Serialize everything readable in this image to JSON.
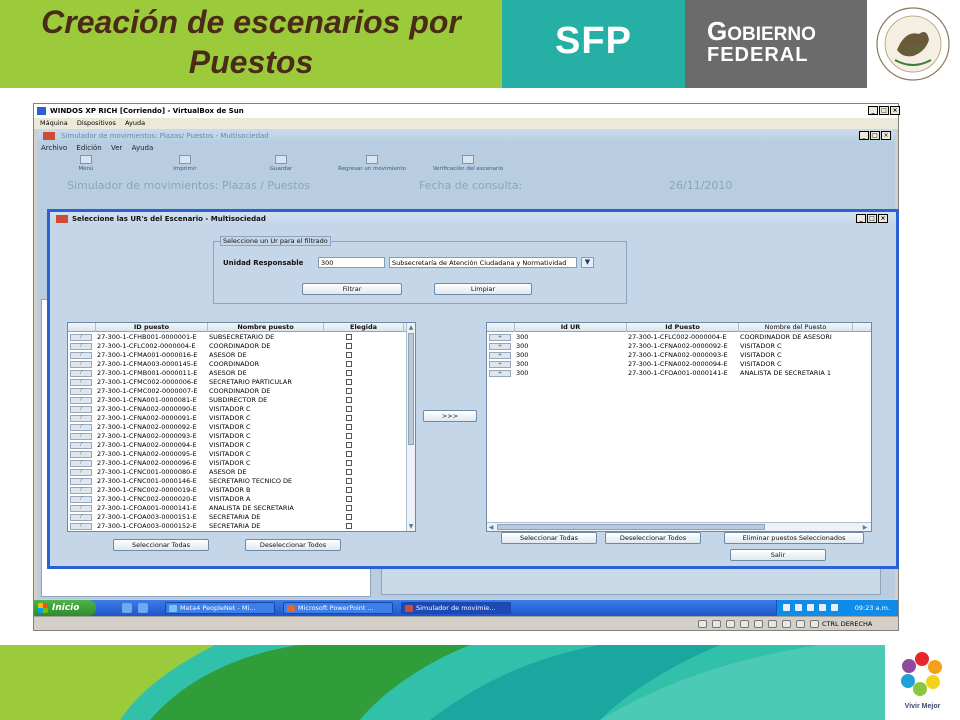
{
  "slide": {
    "title": "Creación de escenarios por Puestos",
    "sfp_logo": "SFP",
    "gobierno_line1": "Gobierno",
    "gobierno_line2": "FEDERAL",
    "seal_text": "ESTADOS UNIDOS MEXICANOS",
    "footer_logo_text": "Vivir Mejor"
  },
  "vm": {
    "title": "WINDOS XP RICH [Corriendo] - VirtualBox de Sun",
    "menu": [
      "Máquina",
      "Dispositivos",
      "Ayuda"
    ],
    "status_text": "CTRL DERECHA"
  },
  "app": {
    "title": "Simulador de movimientos: Plazas/ Puestos - Multisociedad",
    "menu": [
      "Archivo",
      "Edición",
      "Ver",
      "Ayuda"
    ],
    "toolbar": [
      "Menú",
      "Imprimir",
      "Guardar",
      "Regresar un movimiento",
      "Verificación del escenario"
    ],
    "ghost_title": "Simulador de movimientos: Plazas / Puestos",
    "ghost_date_label": "Fecha de consulta:",
    "ghost_date": "26/11/2010"
  },
  "dialog": {
    "title": "Seleccione las UR's del Escenario - Multisociedad",
    "filter_legend": "Seleccione un Ur para el filtrado",
    "unidad_label": "Unidad Responsable",
    "unidad_code": "300",
    "unidad_desc": "Subsecretaría de Atención Ciudadana y Normatividad",
    "filtrar_label": "Filtrar",
    "limpiar_label": "Limpiar",
    "move_label": ">>>",
    "left_select_all": "Seleccionar Todas",
    "left_deselect_all": "Deseleccionar Todos",
    "right_select_all": "Seleccionar Todas",
    "right_deselect_all": "Deseleccionar Todos",
    "remove_selected": "Eliminar puestos Seleccionados",
    "exit_label": "Salir"
  },
  "left_table": {
    "headers": [
      "ID puesto",
      "Nombre puesto",
      "Elegida"
    ],
    "rows": [
      [
        "27-300-1-CFHB001-0000001-E",
        "SUBSECRETARIO DE"
      ],
      [
        "27-300-1-CFLC002-0000004-E",
        "COORDINADOR DE"
      ],
      [
        "27-300-1-CFMA001-0000016-E",
        "ASESOR DE"
      ],
      [
        "27-300-1-CFMA003-0000145-E",
        "COORDINADOR"
      ],
      [
        "27-300-1-CFMB001-0000011-E",
        "ASESOR DE"
      ],
      [
        "27-300-1-CFMC002-0000006-E",
        "SECRETARIO PARTICULAR"
      ],
      [
        "27-300-1-CFMC002-0000007-E",
        "COORDINADOR DE"
      ],
      [
        "27-300-1-CFNA001-0000081-E",
        "SUBDIRECTOR DE"
      ],
      [
        "27-300-1-CFNA002-0000090-E",
        "VISITADOR C"
      ],
      [
        "27-300-1-CFNA002-0000091-E",
        "VISITADOR C"
      ],
      [
        "27-300-1-CFNA002-0000092-E",
        "VISITADOR C"
      ],
      [
        "27-300-1-CFNA002-0000093-E",
        "VISITADOR C"
      ],
      [
        "27-300-1-CFNA002-0000094-E",
        "VISITADOR C"
      ],
      [
        "27-300-1-CFNA002-0000095-E",
        "VISITADOR C"
      ],
      [
        "27-300-1-CFNA002-0000096-E",
        "VISITADOR C"
      ],
      [
        "27-300-1-CFNC001-0000080-E",
        "ASESOR DE"
      ],
      [
        "27-300-1-CFNC001-0000146-E",
        "SECRETARIO TECNICO DE"
      ],
      [
        "27-300-1-CFNC002-0000019-E",
        "VISITADOR B"
      ],
      [
        "27-300-1-CFNC002-0000020-E",
        "VISITADOR A"
      ],
      [
        "27-300-1-CFOA001-0000141-E",
        "ANALISTA DE SECRETARIA"
      ],
      [
        "27-300-1-CFOA003-0000151-E",
        "SECRETARIA DE"
      ],
      [
        "27-300-1-CFOA003-0000152-E",
        "SECRETARIA DE"
      ]
    ]
  },
  "right_table": {
    "headers": [
      "Id UR",
      "Id Puesto",
      "Nombre del Puesto"
    ],
    "rows": [
      [
        "300",
        "27-300-1-CFLC002-0000004-E",
        "COORDINADOR DE ASESORI"
      ],
      [
        "300",
        "27-300-1-CFNA002-0000092-E",
        "VISITADOR C"
      ],
      [
        "300",
        "27-300-1-CFNA002-0000093-E",
        "VISITADOR C"
      ],
      [
        "300",
        "27-300-1-CFNA002-0000094-E",
        "VISITADOR C"
      ],
      [
        "300",
        "27-300-1-CFOA001-0000141-E",
        "ANALISTA DE SECRETARIA 1"
      ]
    ]
  },
  "taskbar": {
    "start": "Inicio",
    "buttons": [
      "Meta4 PeopleNet - Mi...",
      "Microsoft PowerPoint ...",
      "Simulador de movimie..."
    ],
    "clock": "09:23 a.m."
  }
}
